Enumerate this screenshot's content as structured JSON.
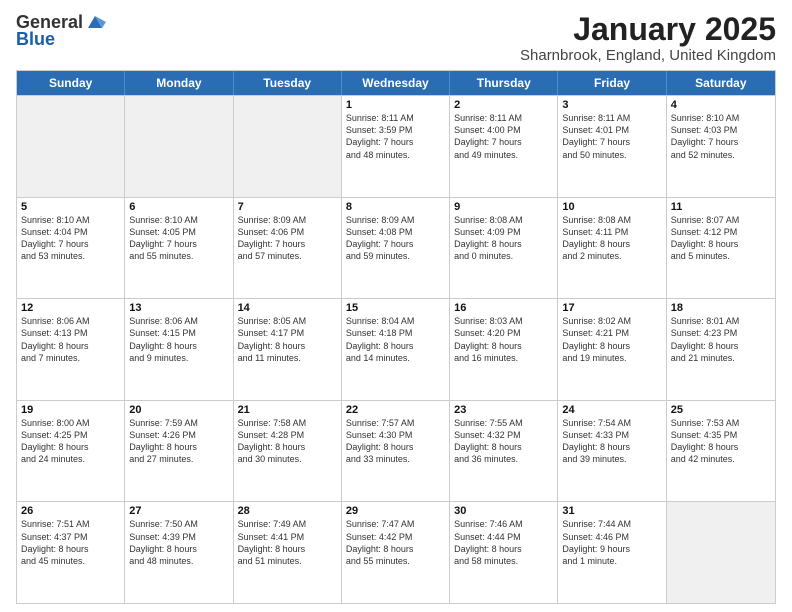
{
  "header": {
    "logo_general": "General",
    "logo_blue": "Blue",
    "month_title": "January 2025",
    "location": "Sharnbrook, England, United Kingdom"
  },
  "weekdays": [
    "Sunday",
    "Monday",
    "Tuesday",
    "Wednesday",
    "Thursday",
    "Friday",
    "Saturday"
  ],
  "rows": [
    [
      {
        "day": "",
        "text": "",
        "shaded": true
      },
      {
        "day": "",
        "text": "",
        "shaded": true
      },
      {
        "day": "",
        "text": "",
        "shaded": true
      },
      {
        "day": "1",
        "text": "Sunrise: 8:11 AM\nSunset: 3:59 PM\nDaylight: 7 hours\nand 48 minutes."
      },
      {
        "day": "2",
        "text": "Sunrise: 8:11 AM\nSunset: 4:00 PM\nDaylight: 7 hours\nand 49 minutes."
      },
      {
        "day": "3",
        "text": "Sunrise: 8:11 AM\nSunset: 4:01 PM\nDaylight: 7 hours\nand 50 minutes."
      },
      {
        "day": "4",
        "text": "Sunrise: 8:10 AM\nSunset: 4:03 PM\nDaylight: 7 hours\nand 52 minutes."
      }
    ],
    [
      {
        "day": "5",
        "text": "Sunrise: 8:10 AM\nSunset: 4:04 PM\nDaylight: 7 hours\nand 53 minutes."
      },
      {
        "day": "6",
        "text": "Sunrise: 8:10 AM\nSunset: 4:05 PM\nDaylight: 7 hours\nand 55 minutes."
      },
      {
        "day": "7",
        "text": "Sunrise: 8:09 AM\nSunset: 4:06 PM\nDaylight: 7 hours\nand 57 minutes."
      },
      {
        "day": "8",
        "text": "Sunrise: 8:09 AM\nSunset: 4:08 PM\nDaylight: 7 hours\nand 59 minutes."
      },
      {
        "day": "9",
        "text": "Sunrise: 8:08 AM\nSunset: 4:09 PM\nDaylight: 8 hours\nand 0 minutes."
      },
      {
        "day": "10",
        "text": "Sunrise: 8:08 AM\nSunset: 4:11 PM\nDaylight: 8 hours\nand 2 minutes."
      },
      {
        "day": "11",
        "text": "Sunrise: 8:07 AM\nSunset: 4:12 PM\nDaylight: 8 hours\nand 5 minutes."
      }
    ],
    [
      {
        "day": "12",
        "text": "Sunrise: 8:06 AM\nSunset: 4:13 PM\nDaylight: 8 hours\nand 7 minutes."
      },
      {
        "day": "13",
        "text": "Sunrise: 8:06 AM\nSunset: 4:15 PM\nDaylight: 8 hours\nand 9 minutes."
      },
      {
        "day": "14",
        "text": "Sunrise: 8:05 AM\nSunset: 4:17 PM\nDaylight: 8 hours\nand 11 minutes."
      },
      {
        "day": "15",
        "text": "Sunrise: 8:04 AM\nSunset: 4:18 PM\nDaylight: 8 hours\nand 14 minutes."
      },
      {
        "day": "16",
        "text": "Sunrise: 8:03 AM\nSunset: 4:20 PM\nDaylight: 8 hours\nand 16 minutes."
      },
      {
        "day": "17",
        "text": "Sunrise: 8:02 AM\nSunset: 4:21 PM\nDaylight: 8 hours\nand 19 minutes."
      },
      {
        "day": "18",
        "text": "Sunrise: 8:01 AM\nSunset: 4:23 PM\nDaylight: 8 hours\nand 21 minutes."
      }
    ],
    [
      {
        "day": "19",
        "text": "Sunrise: 8:00 AM\nSunset: 4:25 PM\nDaylight: 8 hours\nand 24 minutes."
      },
      {
        "day": "20",
        "text": "Sunrise: 7:59 AM\nSunset: 4:26 PM\nDaylight: 8 hours\nand 27 minutes."
      },
      {
        "day": "21",
        "text": "Sunrise: 7:58 AM\nSunset: 4:28 PM\nDaylight: 8 hours\nand 30 minutes."
      },
      {
        "day": "22",
        "text": "Sunrise: 7:57 AM\nSunset: 4:30 PM\nDaylight: 8 hours\nand 33 minutes."
      },
      {
        "day": "23",
        "text": "Sunrise: 7:55 AM\nSunset: 4:32 PM\nDaylight: 8 hours\nand 36 minutes."
      },
      {
        "day": "24",
        "text": "Sunrise: 7:54 AM\nSunset: 4:33 PM\nDaylight: 8 hours\nand 39 minutes."
      },
      {
        "day": "25",
        "text": "Sunrise: 7:53 AM\nSunset: 4:35 PM\nDaylight: 8 hours\nand 42 minutes."
      }
    ],
    [
      {
        "day": "26",
        "text": "Sunrise: 7:51 AM\nSunset: 4:37 PM\nDaylight: 8 hours\nand 45 minutes."
      },
      {
        "day": "27",
        "text": "Sunrise: 7:50 AM\nSunset: 4:39 PM\nDaylight: 8 hours\nand 48 minutes."
      },
      {
        "day": "28",
        "text": "Sunrise: 7:49 AM\nSunset: 4:41 PM\nDaylight: 8 hours\nand 51 minutes."
      },
      {
        "day": "29",
        "text": "Sunrise: 7:47 AM\nSunset: 4:42 PM\nDaylight: 8 hours\nand 55 minutes."
      },
      {
        "day": "30",
        "text": "Sunrise: 7:46 AM\nSunset: 4:44 PM\nDaylight: 8 hours\nand 58 minutes."
      },
      {
        "day": "31",
        "text": "Sunrise: 7:44 AM\nSunset: 4:46 PM\nDaylight: 9 hours\nand 1 minute."
      },
      {
        "day": "",
        "text": "",
        "shaded": true
      }
    ]
  ]
}
